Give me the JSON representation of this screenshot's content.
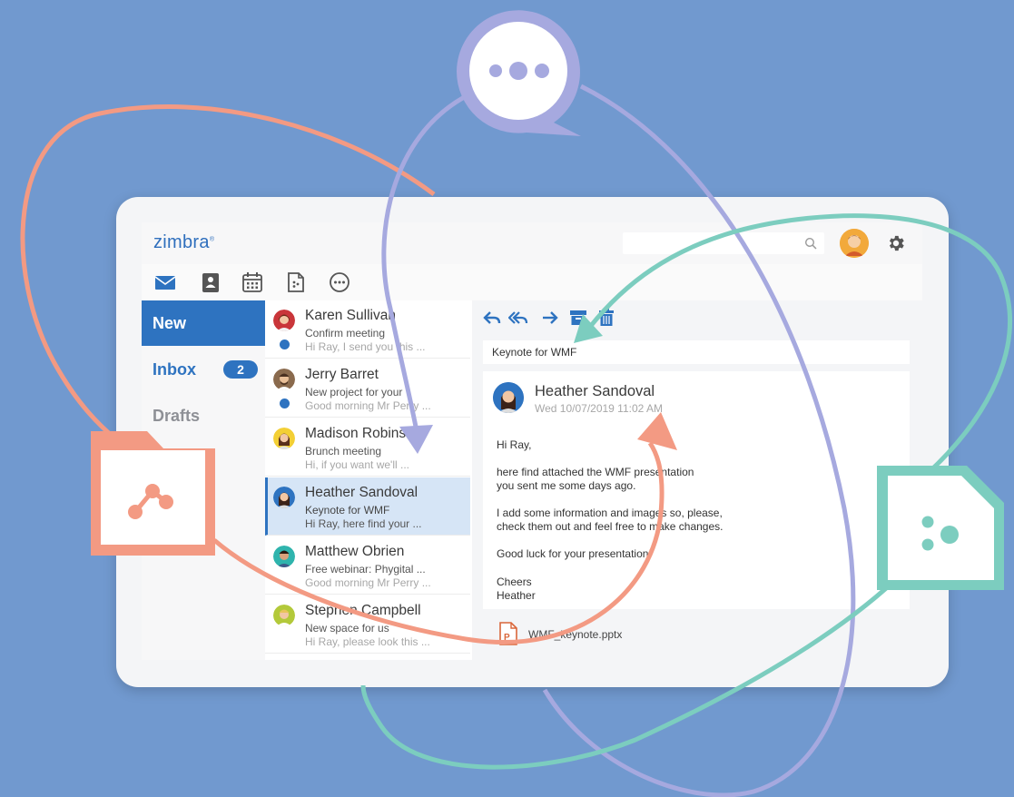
{
  "brand": {
    "logo_text": "zimbra"
  },
  "colors": {
    "background": "#7199cf",
    "accent": "#2e73c0",
    "orange": "#f39a83",
    "purple": "#a6a9df",
    "teal": "#7ccdbf"
  },
  "header": {
    "search_placeholder": "",
    "search_icon": "search-icon",
    "avatar_icon": "user-avatar",
    "settings_icon": "gear-icon"
  },
  "app_bar": {
    "icons": [
      "mail-icon",
      "contacts-icon",
      "calendar-icon",
      "briefcase-file-icon",
      "more-chat-icon"
    ]
  },
  "nav": {
    "new_label": "New",
    "inbox_label": "Inbox",
    "inbox_count": "2",
    "drafts_label": "Drafts"
  },
  "messages": [
    {
      "sender": "Karen Sullivan",
      "subject": "Confirm meeting",
      "preview": "Hi Ray, I send you this ...",
      "unread": true
    },
    {
      "sender": "Jerry Barret",
      "subject": "New project for your",
      "preview": "Good morning Mr Perry ...",
      "unread": true
    },
    {
      "sender": "Madison Robinson",
      "subject": "Brunch meeting",
      "preview": "Hi, if you want we'll ...",
      "unread": false
    },
    {
      "sender": "Heather Sandoval",
      "subject": "Keynote for WMF",
      "preview": "Hi Ray, here find your ...",
      "unread": false,
      "selected": true
    },
    {
      "sender": "Matthew Obrien",
      "subject": "Free webinar: Phygital ...",
      "preview": "Good morning Mr Perry ...",
      "unread": false
    },
    {
      "sender": "Stephen Campbell",
      "subject": "New space for us",
      "preview": "Hi Ray, please look this ...",
      "unread": false
    }
  ],
  "reader": {
    "toolbar_icons": [
      "reply-icon",
      "reply-all-icon",
      "forward-icon",
      "archive-icon",
      "trash-icon"
    ],
    "subject": "Keynote for WMF",
    "from_name": "Heather Sandoval",
    "date": "Wed 10/07/2019 11:02 AM",
    "body": [
      "Hi Ray,",
      "here find attached the WMF presentation",
      "you sent me some days ago.",
      "I add some information and images so, please,",
      "check them out and feel free to make changes.",
      "Good luck for your presentation!",
      "Cheers",
      "Heather"
    ],
    "attachment": "WMF_keynote.pptx"
  },
  "decor": {
    "icons": [
      "chat-bubble-icon",
      "shared-folder-icon",
      "shared-file-icon"
    ]
  }
}
